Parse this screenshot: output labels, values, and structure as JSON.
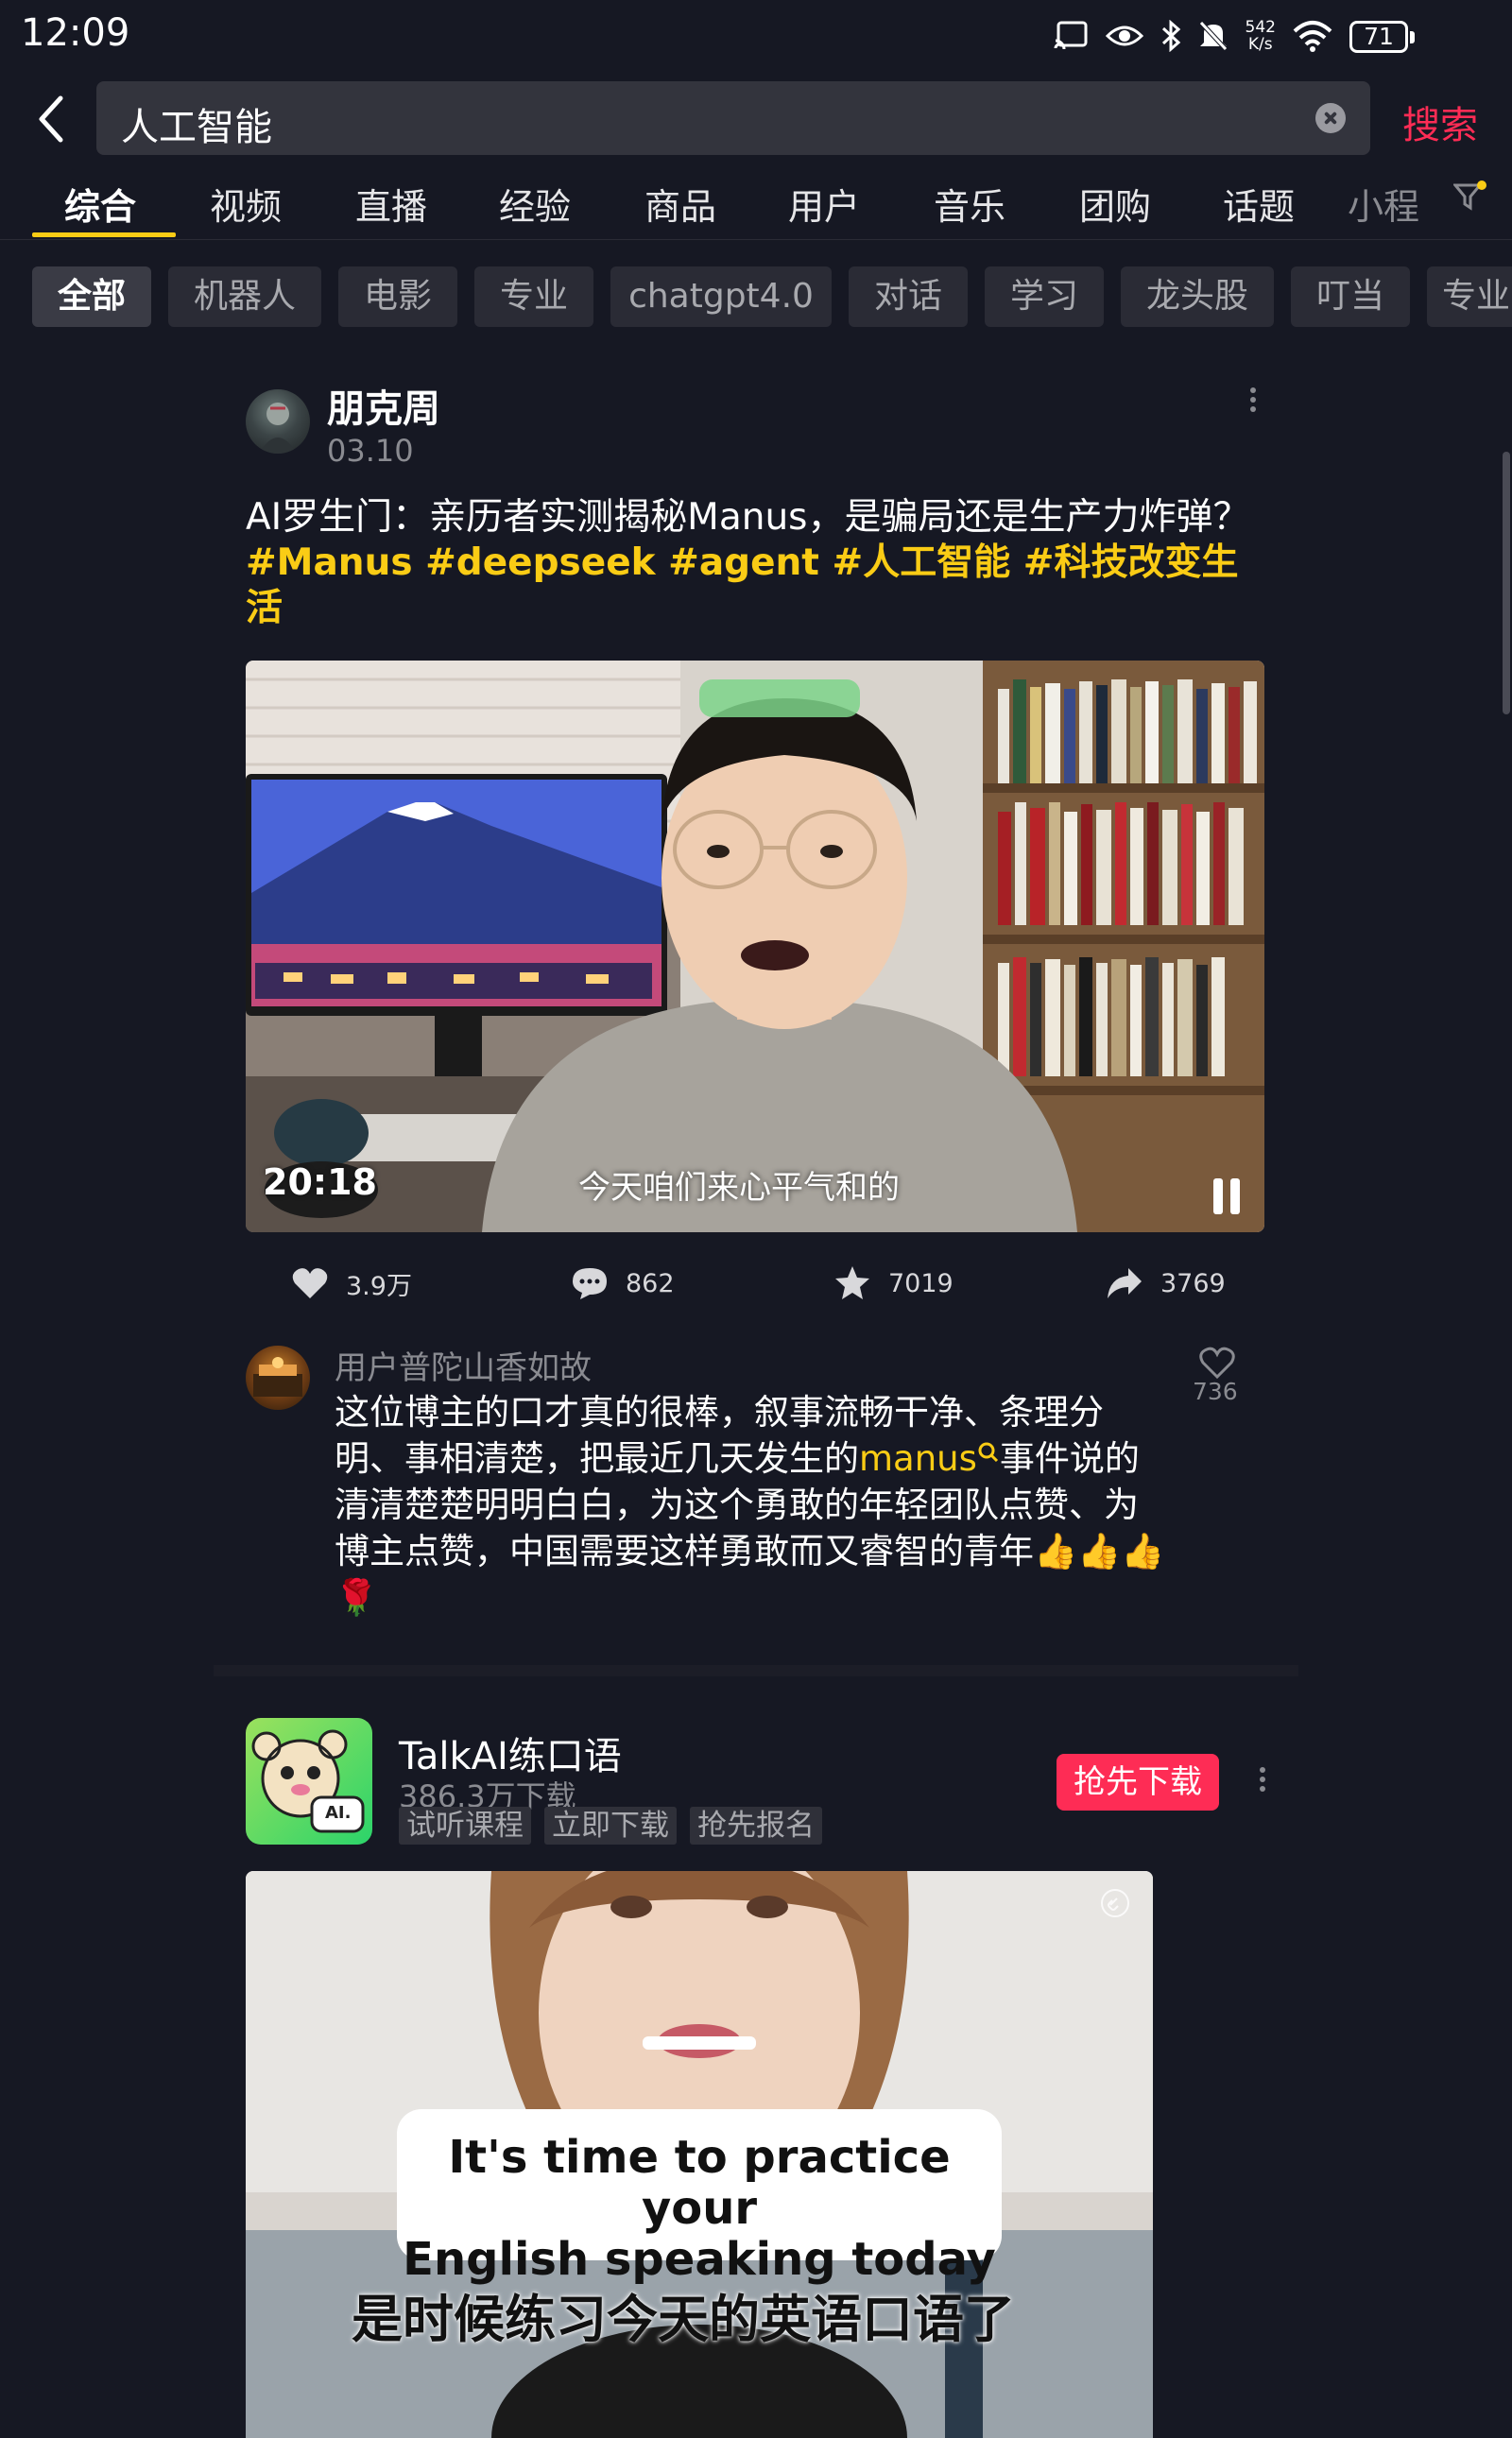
{
  "status_bar": {
    "time": "12:09",
    "net_speed_value": "542",
    "net_speed_unit": "K/s",
    "battery": "71"
  },
  "search": {
    "query": "人工智能",
    "button_label": "搜索"
  },
  "main_tabs": [
    {
      "label": "综合",
      "active": true
    },
    {
      "label": "视频"
    },
    {
      "label": "直播"
    },
    {
      "label": "经验"
    },
    {
      "label": "商品"
    },
    {
      "label": "用户"
    },
    {
      "label": "音乐"
    },
    {
      "label": "团购"
    },
    {
      "label": "话题"
    },
    {
      "label": "小程"
    }
  ],
  "filter_chips": [
    {
      "label": "全部",
      "active": true
    },
    {
      "label": "机器人"
    },
    {
      "label": "电影"
    },
    {
      "label": "专业"
    },
    {
      "label": "chatgpt4.0"
    },
    {
      "label": "对话"
    },
    {
      "label": "学习"
    },
    {
      "label": "龙头股"
    },
    {
      "label": "叮当"
    },
    {
      "label": "专业"
    }
  ],
  "post": {
    "author": "朋克周",
    "date": "03.10",
    "title_text": "AI罗生门：亲历者实测揭秘Manus，是骗局还是生产力炸弹？ ",
    "hashtags": "#Manus #deepseek #agent #人工智能 #科技改变生活",
    "video": {
      "duration": "20:18",
      "subtitle": "今天咱们来心平气和的"
    },
    "actions": {
      "likes": "3.9万",
      "comments": "862",
      "favorites": "7019",
      "shares": "3769"
    },
    "top_comment": {
      "user": "用户普陀山香如故",
      "text_before": "这位博主的口才真的很棒，叙事流畅干净、条理分明、事相清楚，把最近几天发生的",
      "keyword": "manus",
      "text_after": "事件说的清清楚楚明明白白，为这个勇敢的年轻团队点赞、为博主点赞，中国需要这样勇敢而又睿智的青年👍👍👍🌹",
      "likes": "736"
    }
  },
  "ad": {
    "app_name": "TalkAI练口语",
    "downloads": "386.3万下载",
    "tags": [
      "试听课程",
      "立即下载",
      "抢先报名"
    ],
    "download_button": "抢先下载",
    "icon_text": "AI.",
    "caption_en_line1": "It's time to practice your",
    "caption_en_line2": "English speaking today",
    "caption_cn": "是时候练习今天的英语口语了"
  },
  "colors": {
    "background": "#161823",
    "accent_yellow": "#facc15",
    "accent_red": "#fe2c55"
  },
  "icons": [
    "cast-icon",
    "eye-icon",
    "bluetooth-icon",
    "mute-icon",
    "wifi-icon",
    "back-icon",
    "clear-icon",
    "filter-icon",
    "more-icon",
    "heart-icon",
    "comment-icon",
    "star-icon",
    "share-icon",
    "pause-icon",
    "link-icon"
  ]
}
